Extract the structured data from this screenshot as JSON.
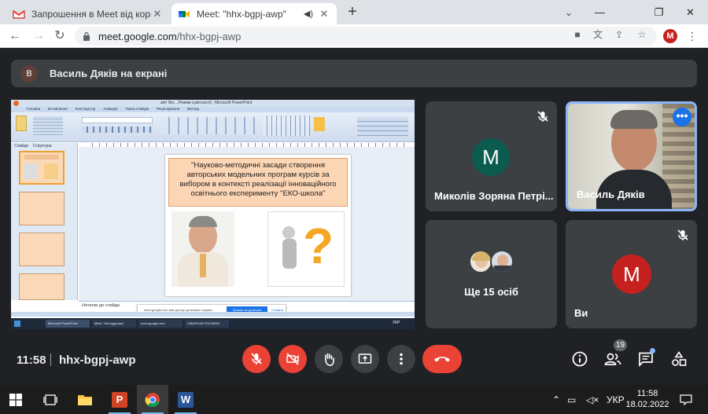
{
  "browser": {
    "tabs": [
      {
        "title": "Запрошення в Meet від користу",
        "favicon": "gmail-icon"
      },
      {
        "title": "Meet: \"hhx-bgpj-awp\"",
        "favicon": "google-meet-icon",
        "active": true
      }
    ],
    "url_host": "meet.google.com",
    "url_path": "/hhx-bgpj-awp",
    "profile_initial": "M"
  },
  "meeting": {
    "presenting_avatar_initial": "B",
    "presenting_banner": "Василь Дяків на екрані",
    "time": "11:58",
    "code": "hhx-bgpj-awp",
    "participants_count": "19"
  },
  "slide": {
    "window_title": "звіт без ...Режим сумісності] - Microsoft PowerPoint",
    "title": "\"Науково-методичні засади створення авторських модельних програм курсів за вибором в контексті реалізації інноваційного освітнього експерименту \"ЕКО-школа\"",
    "notes_label": "Нотатки до слайда",
    "banner_text": "meet.google.com має доступ до вашого екрана",
    "stop_sharing": "Більше не ділитися",
    "hide": "Сховати",
    "tabs": [
      "Головна",
      "Вставлення",
      "Конструктор",
      "Анімація",
      "Показ слайдів",
      "Рецензування",
      "Вигляд"
    ],
    "panel_tabs": [
      "Слайди",
      "Структура"
    ],
    "taskbar_items": [
      "Microsoft PowerPoint",
      "Meet: \"hhx-bgpj-awp\"",
      "meet.google.com",
      "ЛІКАРСЬКІ РОСЛИНИ"
    ],
    "tray_lang": "УКР"
  },
  "tiles": [
    {
      "name": "Миколів Зоряна Петрі...",
      "initial": "M",
      "color": "#0b5c4f"
    },
    {
      "name": "Василь Дяків"
    },
    {
      "label": "Ще 15 осіб"
    },
    {
      "name": "Ви",
      "initial": "M",
      "color": "#c5221f"
    }
  ],
  "taskbar": {
    "lang": "УКР",
    "time": "11:58",
    "date": "18.02.2022"
  },
  "colors": {
    "meet_bg": "#202124",
    "tile_bg": "#3c4043",
    "red": "#ea4335",
    "accent": "#8ab4f8"
  }
}
